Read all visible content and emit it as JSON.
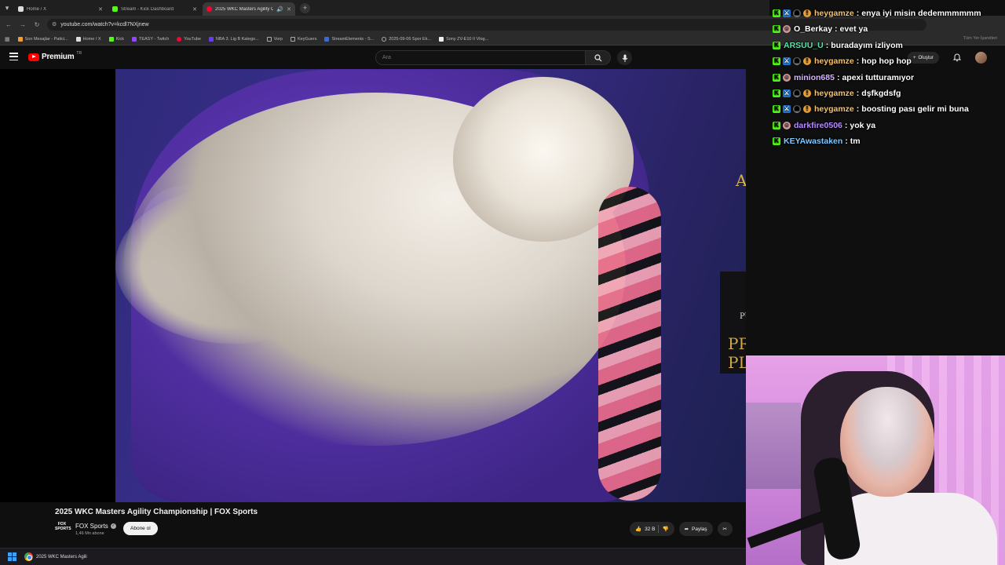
{
  "browser": {
    "tabs": [
      {
        "title": "Home / X",
        "color": "#222222",
        "active": false
      },
      {
        "title": "Stream - Kick Dashboard",
        "color": "#53fc18",
        "active": false
      },
      {
        "title": "2025 WKC Masters Agility C",
        "color": "#ff0033",
        "active": true
      }
    ],
    "url": "youtube.com/watch?v=kcdl7NXjnew",
    "bookmarks": [
      "Son Mesajlar - Patici...",
      "Home / X",
      "Kick",
      "TEASY - Twitch",
      "YouTube",
      "NBA 3. Lig B Katego...",
      "Vorp",
      "KeyGuers",
      "StreamElements - S...",
      "2025-09-06 Spor Ek...",
      "Sony ZV-E10 II Vlog..."
    ],
    "bookmarks_right": "Tüm Yer İşaretleri"
  },
  "youtube": {
    "brand": "Premium",
    "country": "TR",
    "search_placeholder": "Ara",
    "create_label": "Oluştur",
    "video": {
      "title": "2025 WKC Masters Agility Championship | FOX Sports",
      "banner_text": "AGILITY",
      "sponsor_top": "PURINA",
      "sponsor_bottom": "PRO PLAN"
    },
    "channel": {
      "logo_text": "FOX SPORTS",
      "name": "FOX Sports",
      "subscribers": "1,46 Mn abone",
      "subscribe_label": "Abone ol"
    },
    "actions": {
      "likes": "32 B",
      "share_label": "Paylaş"
    }
  },
  "taskbar": {
    "app_title": "2025 WKC Masters Agili"
  },
  "chat": {
    "messages": [
      {
        "user": "heygamze",
        "text": "enya iyi misin dedemmmmmm",
        "color": "#f5c16c",
        "badges": [
          "kick",
          "vip",
          "mod",
          "sub"
        ]
      },
      {
        "user": "O_Berkay",
        "text": "evet ya",
        "color": "#ffffff",
        "badges": [
          "kick",
          "face"
        ]
      },
      {
        "user": "ARSUU_U",
        "text": "buradayım izliyom",
        "color": "#5be0a8",
        "badges": [
          "kick"
        ]
      },
      {
        "user": "heygamze",
        "text": "hop hop hop",
        "color": "#f5c16c",
        "badges": [
          "kick",
          "vip",
          "mod",
          "sub"
        ]
      },
      {
        "user": "minion685",
        "text": "apexi tutturamıyor",
        "color": "#d8b4ff",
        "badges": [
          "kick",
          "face"
        ]
      },
      {
        "user": "heygamze",
        "text": "dşfkgdsfg",
        "color": "#f5c16c",
        "badges": [
          "kick",
          "vip",
          "mod",
          "sub"
        ]
      },
      {
        "user": "heygamze",
        "text": "boosting pası gelir mi buna",
        "color": "#f5c16c",
        "badges": [
          "kick",
          "vip",
          "mod",
          "sub"
        ]
      },
      {
        "user": "darkfire0506",
        "text": "yok ya",
        "color": "#b48aff",
        "badges": [
          "kick",
          "face"
        ]
      },
      {
        "user": "KEYAwastaken",
        "text": "tm",
        "color": "#7ec8ff",
        "badges": [
          "kick"
        ]
      }
    ]
  }
}
